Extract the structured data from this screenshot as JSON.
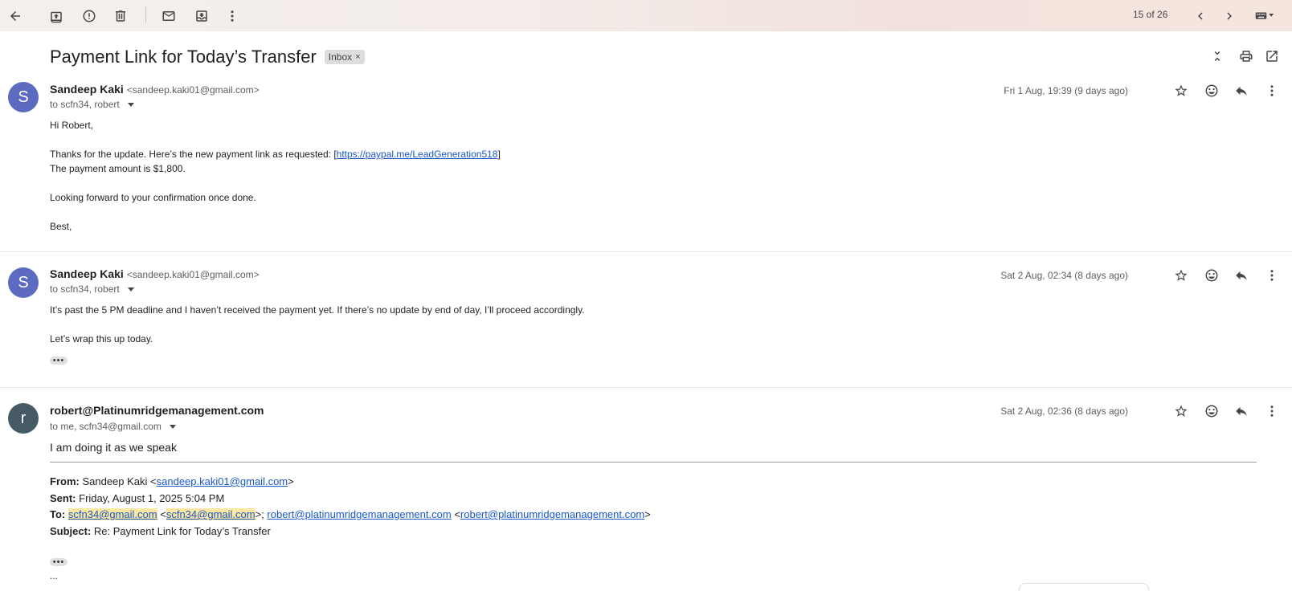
{
  "toolbar": {
    "pager": "15 of 26"
  },
  "thread": {
    "subject": "Payment Link for Today’s Transfer",
    "label": "Inbox",
    "label_remove": "×"
  },
  "messages": [
    {
      "avatar_letter": "S",
      "avatar_color": "#5c6bc0",
      "sender_name": "Sandeep Kaki",
      "sender_email": "<sandeep.kaki01@gmail.com>",
      "to_line": "to scfn34, robert",
      "date": "Fri 1 Aug, 19:39 (9 days ago)",
      "body": {
        "greeting": "Hi Robert,",
        "line1_prefix": "Thanks for the update. Here’s the new payment link as requested: [",
        "link": "https://paypal.me/LeadGeneration518",
        "line1_suffix": "]",
        "line2": "The payment amount is $1,800.",
        "line3": "Looking forward to your confirmation once done.",
        "signoff": "Best,"
      }
    },
    {
      "avatar_letter": "S",
      "avatar_color": "#5c6bc0",
      "sender_name": "Sandeep Kaki",
      "sender_email": "<sandeep.kaki01@gmail.com>",
      "to_line": "to scfn34, robert",
      "date": "Sat 2 Aug, 02:34 (8 days ago)",
      "body": {
        "line1": "It’s past the 5 PM deadline and I haven’t received the payment yet. If there’s no update by end of day, I’ll proceed accordingly.",
        "line2": "Let’s wrap this up today."
      },
      "more": "•••"
    },
    {
      "avatar_letter": "r",
      "avatar_color": "#455a64",
      "sender_name": "robert@Platinumridgemanagement.com",
      "to_line": "to me, scfn34@gmail.com",
      "date": "Sat 2 Aug, 02:36 (8 days ago)",
      "reply": "I am doing it as we speak",
      "quoted": {
        "from_label": "From:",
        "from_name": "Sandeep Kaki <",
        "from_email": "sandeep.kaki01@gmail.com",
        "from_close": ">",
        "sent_label": "Sent:",
        "sent_value": "Friday, August 1, 2025 5:04 PM",
        "to_label": "To:",
        "to_email1": "scfn34@gmail.com",
        "to_sep1": "<",
        "to_email1b": "scfn34@gmail.com",
        "to_sep2": ">; ",
        "to_email2": "robert@platinumridgemanagement.com",
        "to_sep3": "<",
        "to_email2b": "robert@platinumridgemanagement.com",
        "to_close": ">",
        "subject_label": "Subject:",
        "subject_value": "Re: Payment Link for Today’s Transfer"
      },
      "more": "•••",
      "ellipsis": "..."
    }
  ]
}
